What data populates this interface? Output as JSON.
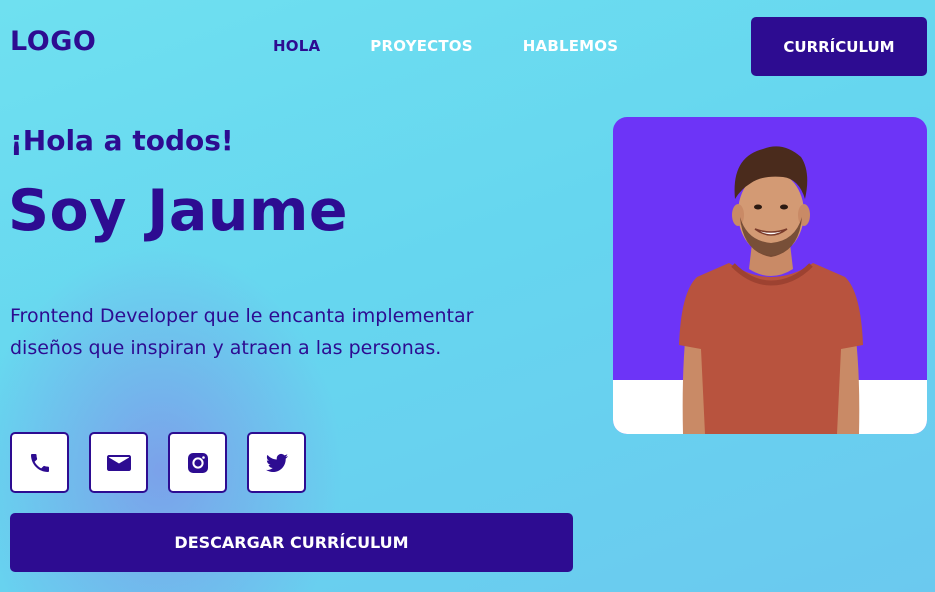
{
  "header": {
    "logo": "LOGO",
    "nav": [
      {
        "label": "HOLA",
        "active": true
      },
      {
        "label": "PROYECTOS",
        "active": false
      },
      {
        "label": "HABLEMOS",
        "active": false
      }
    ],
    "cv_button": "CURRÍCULUM"
  },
  "hero": {
    "greeting": "¡Hola a todos!",
    "name": "Soy Jaume",
    "description": "Frontend Developer que le encanta implementar diseños que inspiran y atraen a las personas.",
    "socials": [
      {
        "icon": "phone-icon"
      },
      {
        "icon": "mail-icon"
      },
      {
        "icon": "instagram-icon"
      },
      {
        "icon": "twitter-icon"
      }
    ],
    "download_button": "DESCARGAR CURRÍCULUM"
  },
  "colors": {
    "primary": "#2d0c91",
    "photo_background": "#6d34f7",
    "background": "#66d6ef",
    "nav_inactive": "#ffffff"
  }
}
